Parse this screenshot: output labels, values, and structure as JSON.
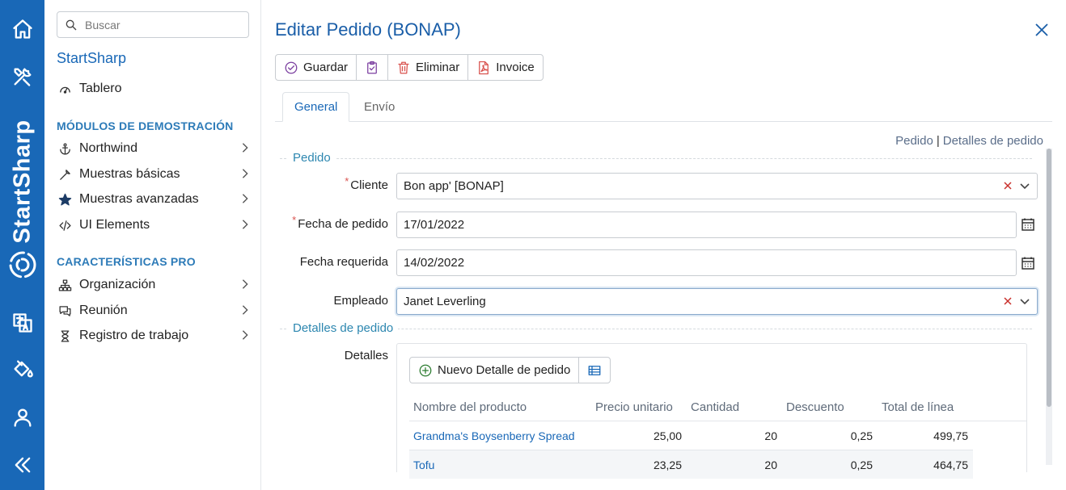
{
  "sidebar": {
    "search_placeholder": "Buscar",
    "title": "StartSharp",
    "dashboard": "Tablero",
    "section_demo": "MÓDULOS DE DEMOSTRACIÓN",
    "demo_items": [
      "Northwind",
      "Muestras básicas",
      "Muestras avanzadas",
      "UI Elements"
    ],
    "section_pro": "CARACTERÍSTICAS PRO",
    "pro_items": [
      "Organización",
      "Reunión",
      "Registro de trabajo"
    ]
  },
  "rail": {
    "brand": "StartSharp",
    "icons": [
      "home-icon",
      "tools-icon",
      "translate-icon",
      "paint-bucket-icon",
      "user-icon",
      "collapse-icon"
    ]
  },
  "dialog": {
    "title": "Editar Pedido (BONAP)",
    "toolbar": {
      "save": "Guardar",
      "delete": "Eliminar",
      "invoice": "Invoice"
    },
    "tabs": [
      "General",
      "Envío"
    ],
    "crumbs": [
      "Pedido",
      "Detalles de pedido"
    ],
    "section_order": "Pedido",
    "section_details": "Detalles de pedido",
    "fields": {
      "customer": {
        "label": "Cliente",
        "value": "Bon app' [BONAP]"
      },
      "order_date": {
        "label": "Fecha de pedido",
        "value": "17/01/2022"
      },
      "required_date": {
        "label": "Fecha requerida",
        "value": "14/02/2022"
      },
      "employee": {
        "label": "Empleado",
        "value": "Janet Leverling"
      }
    },
    "details_label": "Detalles",
    "grid": {
      "new_button": "Nuevo Detalle de pedido",
      "headers": [
        "Nombre del producto",
        "Precio unitario",
        "Cantidad",
        "Descuento",
        "Total de línea"
      ],
      "rows": [
        [
          "Grandma's Boysenberry Spread",
          "25,00",
          "20",
          "0,25",
          "499,75"
        ],
        [
          "Tofu",
          "23,25",
          "20",
          "0,25",
          "464,75"
        ]
      ]
    }
  },
  "colors": {
    "rail": "#1968b7",
    "accent": "#1968b7",
    "legend": "#2d87b0"
  }
}
